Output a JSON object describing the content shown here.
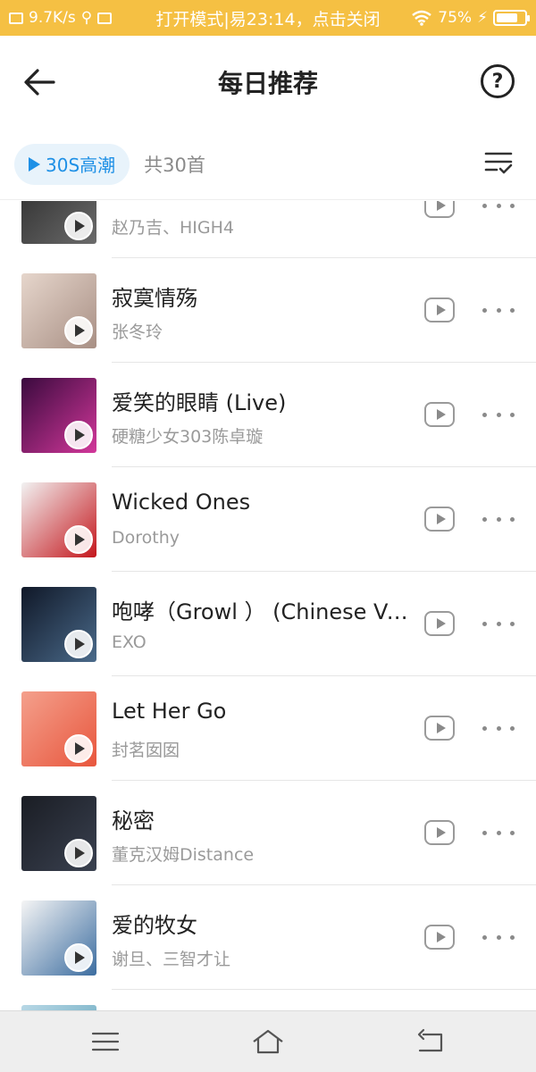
{
  "status_bar": {
    "net_speed": "9.7K/s",
    "center_text": "打开模式|易23:14，点击关闭",
    "battery": "75%",
    "battery_level": 0.75
  },
  "header": {
    "title": "每日推荐",
    "help": "?"
  },
  "toolbar": {
    "chip_label": "30S高潮",
    "count": "共30首"
  },
  "songs": [
    {
      "title": "",
      "artist": "赵乃吉、HIGH4",
      "cover_colors": [
        "#2b2b2b",
        "#6b6b6b"
      ]
    },
    {
      "title": "寂寞情殇",
      "artist": "张冬玲",
      "cover_colors": [
        "#e6d6cc",
        "#a88f84"
      ]
    },
    {
      "title": "爱笑的眼睛 (Live)",
      "artist": "硬糖少女303陈卓璇",
      "cover_colors": [
        "#3a0a3e",
        "#d2379a"
      ]
    },
    {
      "title": "Wicked Ones",
      "artist": "Dorothy",
      "cover_colors": [
        "#f2f2f2",
        "#c4161c"
      ]
    },
    {
      "title": "咆哮（Growl ） (Chinese Version)",
      "artist": "EXO",
      "cover_colors": [
        "#101828",
        "#4a6a8a"
      ]
    },
    {
      "title": "Let Her Go",
      "artist": "封茗囡囡",
      "cover_colors": [
        "#f4a08c",
        "#e8563d"
      ]
    },
    {
      "title": "秘密",
      "artist": "董克汉姆Distance",
      "cover_colors": [
        "#1a1d24",
        "#3a4150"
      ]
    },
    {
      "title": "爱的牧女",
      "artist": "谢旦、三智才让",
      "cover_colors": [
        "#f5f5f5",
        "#3c6da0"
      ]
    },
    {
      "title": "",
      "artist": "",
      "cover_colors": [
        "#b8d8e6",
        "#5aa0b8"
      ]
    }
  ],
  "icons": {
    "back": "arrow-left-icon",
    "help": "question-circle-icon",
    "sort": "sort-list-icon",
    "nav_menu": "menu-icon",
    "nav_home": "home-icon",
    "nav_back": "return-icon"
  }
}
